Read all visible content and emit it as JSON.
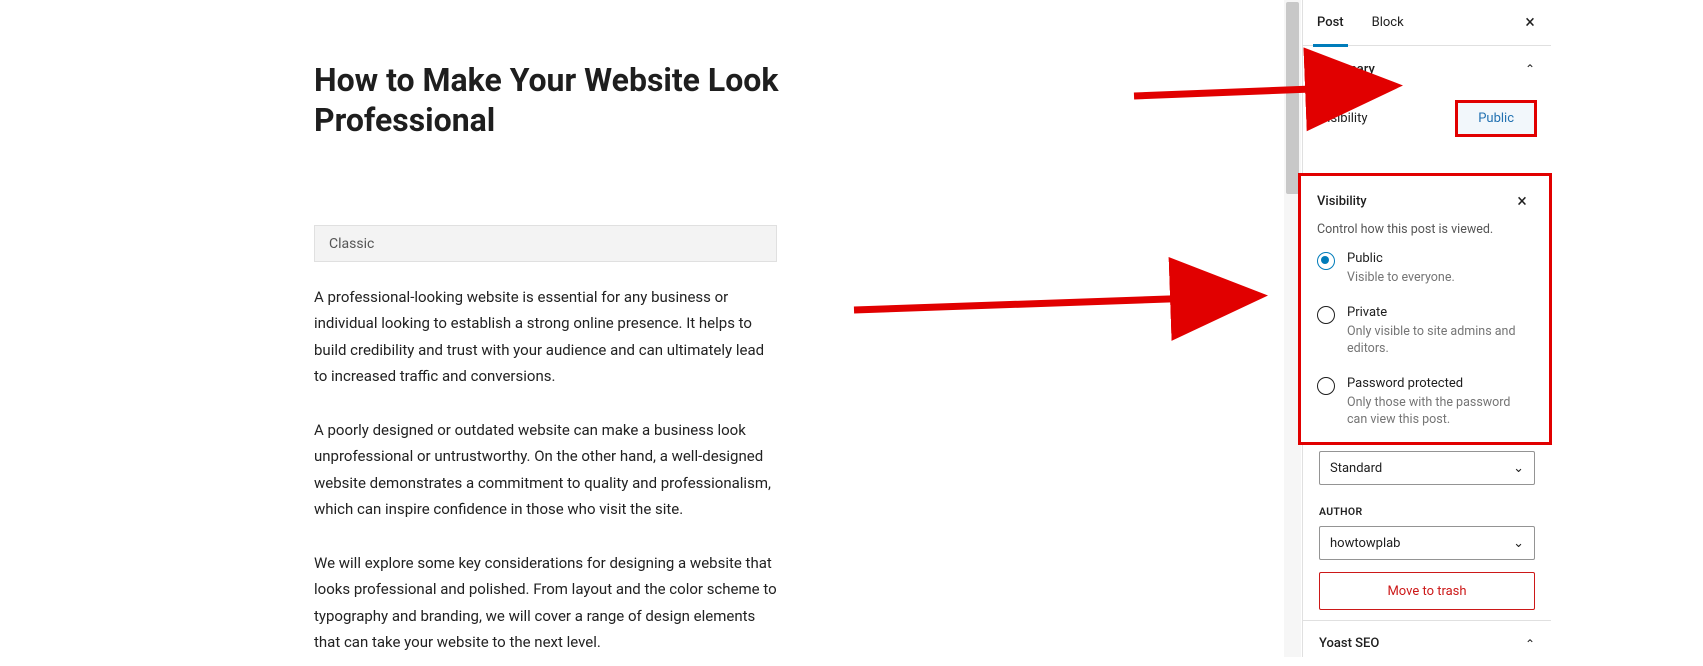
{
  "editor": {
    "title": "How to Make Your Website Look Professional",
    "classic_label": "Classic",
    "p1": "A professional-looking website is essential for any business or individual looking to establish a strong online presence. It helps to build credibility and trust with your audience and can ultimately lead to increased traffic and conversions.",
    "p2": "A poorly designed or outdated website can make a business look unprofessional or untrustworthy. On the other hand, a well-designed website demonstrates a commitment to quality and professionalism, which can inspire confidence in those who visit the site.",
    "p3": "We will explore some key considerations for designing a website that looks professional and polished. From layout and the color scheme to typography and branding, we will cover a range of design elements that can take your website to the next level."
  },
  "sidebar": {
    "tabs": {
      "post": "Post",
      "block": "Block"
    },
    "summary": {
      "heading": "Summary",
      "visibility_label": "Visibility",
      "visibility_value": "Public"
    },
    "popover": {
      "title": "Visibility",
      "desc": "Control how this post is viewed.",
      "options": [
        {
          "title": "Public",
          "desc": "Visible to everyone.",
          "selected": true
        },
        {
          "title": "Private",
          "desc": "Only visible to site admins and editors.",
          "selected": false
        },
        {
          "title": "Password protected",
          "desc": "Only those with the password can view this post.",
          "selected": false
        }
      ]
    },
    "format": {
      "value": "Standard"
    },
    "author": {
      "label": "AUTHOR",
      "value": "howtowplab"
    },
    "trash": "Move to trash",
    "yoast": "Yoast SEO"
  }
}
